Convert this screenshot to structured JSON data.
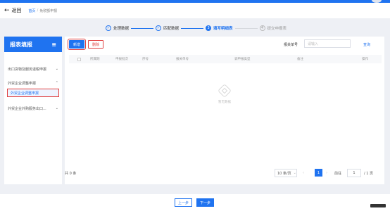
{
  "header": {
    "back_label": "返回",
    "breadcrumb": [
      "首页",
      "免税额申报"
    ]
  },
  "steps": [
    {
      "label": "处理数据",
      "status": "done",
      "mark": "✓"
    },
    {
      "label": "匹配数据",
      "status": "done",
      "mark": "✓"
    },
    {
      "label": "填写明细表",
      "status": "active",
      "mark": "3"
    },
    {
      "label": "提交申报表",
      "status": "pending",
      "mark": "4"
    }
  ],
  "sidebar": {
    "title": "报表填报",
    "menu_icon": "menu-icon",
    "items": [
      {
        "label": "出口货物及服务退税申报",
        "expanded": false
      },
      {
        "label": "外贸企业调整申报",
        "expanded": true
      },
      {
        "label": "外贸企业外购服务出口...",
        "expanded": false
      }
    ],
    "active_sub": "外贸企业调整申报"
  },
  "toolbar": {
    "add_label": "新增",
    "delete_label": "删除",
    "filing_label": "报关单号",
    "filing_placeholder": "请输入",
    "search_label": "查询"
  },
  "table": {
    "columns": [
      "所属期",
      "申报批次",
      "序号",
      "报关单号",
      "调申报类型",
      "备注",
      "操作"
    ],
    "rows": [],
    "empty_text": "暂无数据"
  },
  "pagination": {
    "total_text": "共 0 条",
    "page_size": "10 条/页",
    "current_page": "1",
    "goto_label": "前往",
    "goto_value": "1",
    "total_pages": "/ 1 页"
  },
  "footer": {
    "prev_label": "上一步",
    "next_label": "下一步"
  }
}
